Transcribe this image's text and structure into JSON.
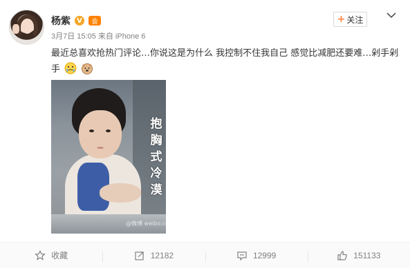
{
  "post": {
    "user_name": "杨紫",
    "verified_badge": "V",
    "member_badge": "会",
    "meta": "3月7日 15:05 来自 iPhone 6",
    "follow_label": "关注",
    "text": "最近总喜欢抢热门评论…你说这是为什么 我控制不住我自己 感觉比减肥还要难…剁手剁手",
    "image_caption": "抱胸式冷漠",
    "image_watermark": "@微博 weibo.com"
  },
  "actions": [
    {
      "label": "收藏",
      "icon": "star-icon"
    },
    {
      "label": "12182",
      "icon": "repost-icon"
    },
    {
      "label": "12999",
      "icon": "comment-icon"
    },
    {
      "label": "151133",
      "icon": "like-icon"
    }
  ],
  "colors": {
    "accent": "#ff8140",
    "vip": "#f5a623",
    "muted": "#808080"
  }
}
